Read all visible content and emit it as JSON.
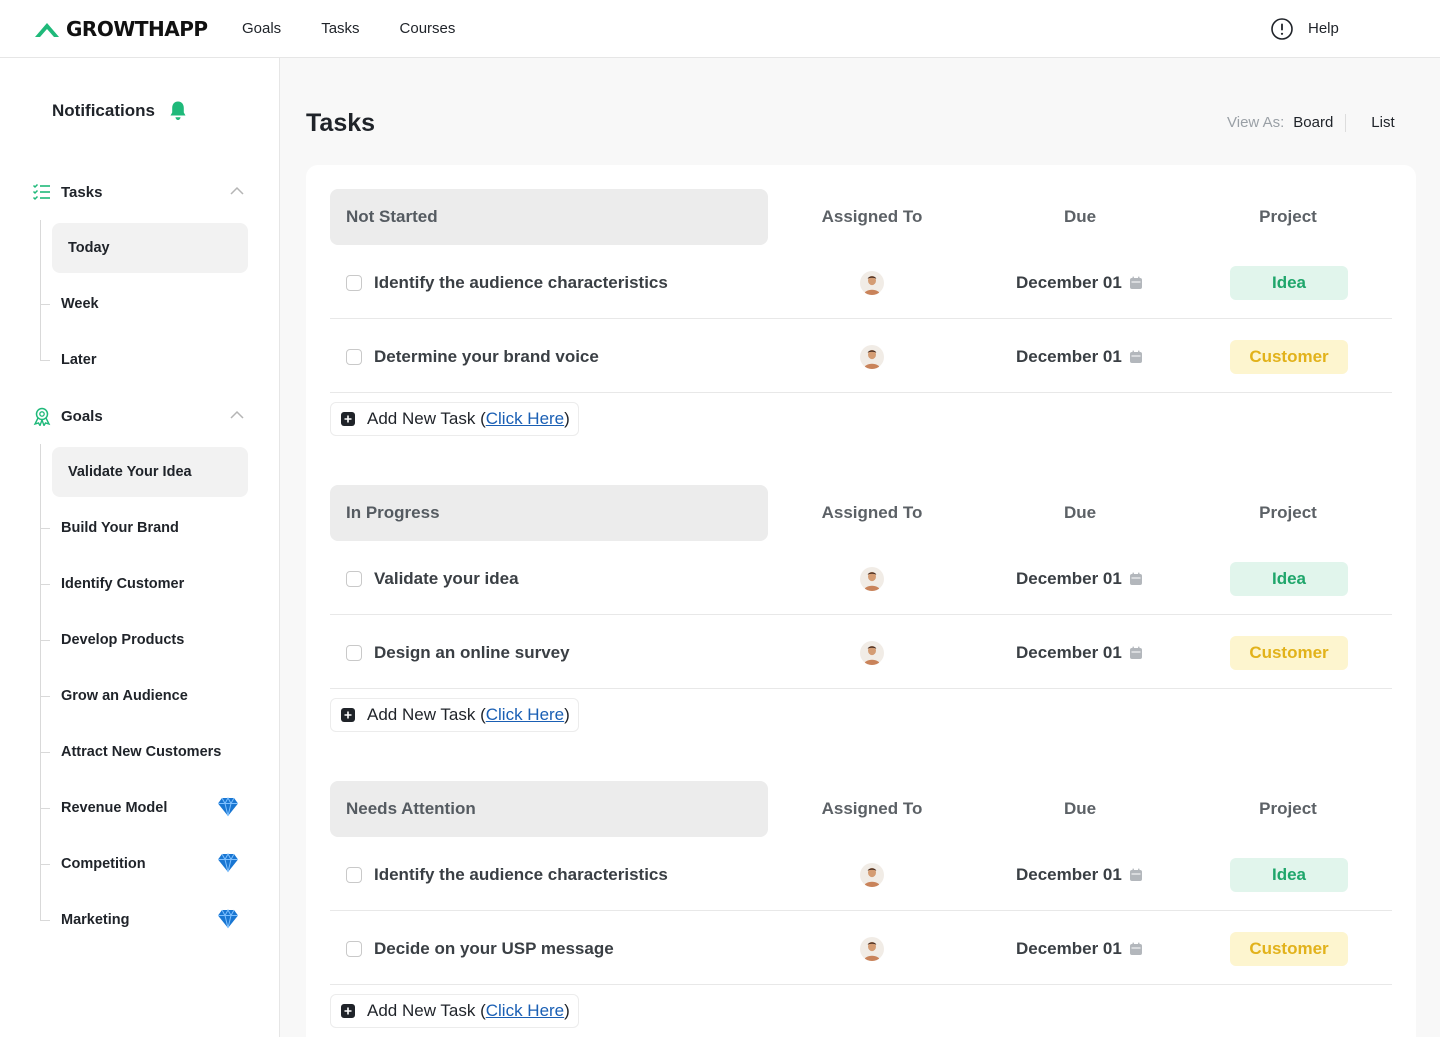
{
  "app": {
    "name": "GROWTHAPP",
    "brand_color": "#1fb97a"
  },
  "topnav": {
    "items": [
      "Goals",
      "Tasks",
      "Courses"
    ],
    "help_label": "Help"
  },
  "sidebar": {
    "notifications_label": "Notifications",
    "tasks_section": {
      "label": "Tasks",
      "items": [
        "Today",
        "Week",
        "Later"
      ],
      "active": "Today"
    },
    "goals_section": {
      "label": "Goals",
      "items": [
        "Validate Your Idea",
        "Build Your Brand",
        "Identify Customer",
        "Develop Products",
        "Grow an Audience",
        "Attract New Customers",
        "Revenue Model",
        "Competition",
        "Marketing"
      ],
      "premium_items": [
        "Revenue Model",
        "Competition",
        "Marketing"
      ],
      "active": "Validate Your Idea"
    }
  },
  "main": {
    "title": "Tasks",
    "view_as": {
      "label": "View As:",
      "options": [
        "Board",
        "List"
      ]
    },
    "columns": {
      "assigned": "Assigned To",
      "due": "Due",
      "project": "Project"
    },
    "add_task": {
      "prefix": "Add New Task (",
      "link": "Click Here",
      "suffix": ")"
    },
    "groups": [
      {
        "title": "Not Started",
        "tasks": [
          {
            "name": "Identify the audience characteristics",
            "due": "December 01",
            "project": "Idea"
          },
          {
            "name": "Determine your brand voice",
            "due": "December 01",
            "project": "Customer"
          }
        ]
      },
      {
        "title": "In Progress",
        "tasks": [
          {
            "name": "Validate your idea",
            "due": "December 01",
            "project": "Idea"
          },
          {
            "name": "Design an online survey",
            "due": "December 01",
            "project": "Customer"
          }
        ]
      },
      {
        "title": "Needs Attention",
        "tasks": [
          {
            "name": "Identify the audience characteristics",
            "due": "December 01",
            "project": "Idea"
          },
          {
            "name": "Decide on your USP message",
            "due": "December 01",
            "project": "Customer"
          }
        ]
      }
    ],
    "project_colors": {
      "Idea": {
        "bg": "#e1f5ec",
        "fg": "#1fa66b"
      },
      "Customer": {
        "bg": "#fdf5cf",
        "fg": "#e2b21b"
      }
    }
  }
}
